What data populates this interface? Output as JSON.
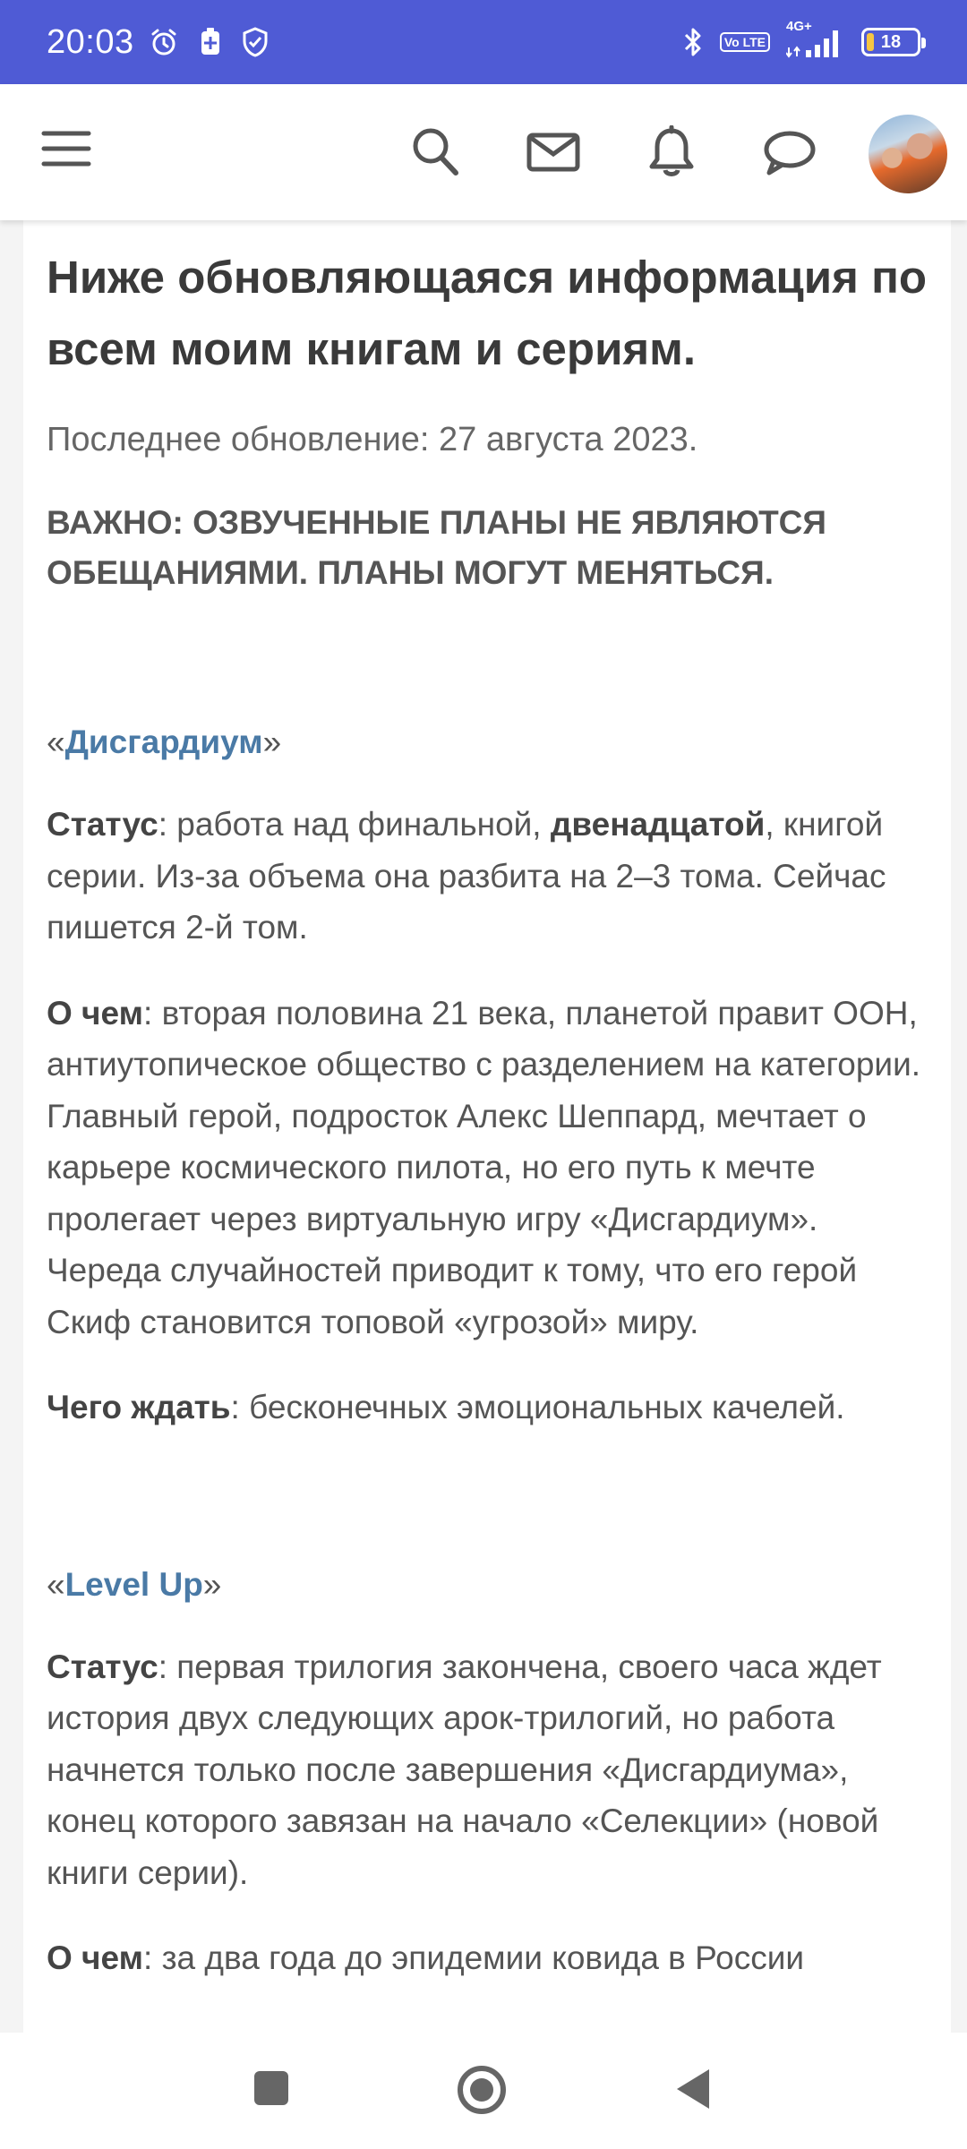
{
  "status_bar": {
    "time": "20:03",
    "left_icons": [
      "alarm-icon",
      "battery-saver-icon",
      "shield-icon"
    ],
    "lte_label": "Vo LTE",
    "network_label": "4G+",
    "battery_level": "18",
    "color": "#4f5bd5"
  },
  "app_bar": {
    "icons": [
      "menu-icon",
      "search-icon",
      "mail-icon",
      "bell-icon",
      "chat-icon"
    ],
    "avatar": "user-avatar"
  },
  "article": {
    "title": "Ниже обновляющаяся информация по всем моим книгам и сериям.",
    "update_line": "Последнее обновление: 27 августа 2023.",
    "important": "ВАЖНО: ОЗВУЧЕННЫЕ ПЛАНЫ НЕ ЯВЛЯЮТСЯ ОБЕЩАНИЯМИ. ПЛАНЫ МОГУТ МЕНЯТЬСЯ.",
    "sections": [
      {
        "quote_open": "«",
        "title": "Дисгардиум",
        "quote_close": "»",
        "status_label": "Статус",
        "status_text_1": ": работа над финальной, ",
        "status_bold": "двенадцатой",
        "status_text_2": ", книгой серии. Из-за объема она разбита на 2–3 тома. Сейчас пишется 2-й том.",
        "about_label": "О чем",
        "about_text": ": вторая половина 21 века, планетой правит ООН, антиутопическое общество с разделением на категории. Главный герой, подросток Алекс Шеппард, мечтает о карьере космического пилота, но его путь к мечте пролегает через виртуальную игру «Дисгардиум». Череда случайностей приводит к тому, что его герой Скиф становится топовой «угрозой» миру.",
        "expect_label": "Чего ждать",
        "expect_text": ": бесконечных эмоциональных качелей."
      },
      {
        "quote_open": "«",
        "title": "Level Up",
        "quote_close": "»",
        "status_label": "Статус",
        "status_text": ": первая трилогия закончена, своего часа ждет история двух следующих арок-трилогий, но работа начнется только после завершения «Дисгардиума», конец которого завязан на начало «Селекции» (новой книги серии).",
        "about_label": "О чем",
        "about_text": ": за два года до эпидемии ковида в России"
      }
    ],
    "link_color": "#4a7aa6"
  },
  "nav_bar": {
    "buttons": [
      "recent-apps-button",
      "home-button",
      "back-button"
    ]
  }
}
